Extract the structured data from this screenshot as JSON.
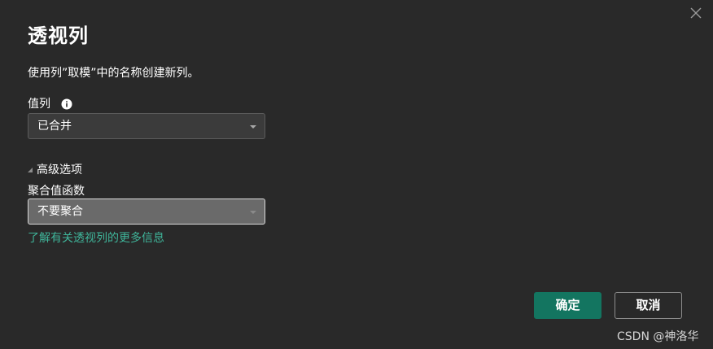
{
  "dialog": {
    "title": "透视列",
    "description": "使用列”取模”中的名称创建新列。",
    "close_icon": "close-icon"
  },
  "value_column": {
    "label": "值列",
    "info_icon": "info-icon",
    "selected": "已合并"
  },
  "advanced": {
    "label": "高级选项",
    "expanded": true
  },
  "aggregate": {
    "label": "聚合值函数",
    "selected": "不要聚合"
  },
  "link": {
    "text": "了解有关透视列的更多信息"
  },
  "buttons": {
    "ok": "确定",
    "cancel": "取消"
  },
  "watermark": "CSDN @神洛华",
  "colors": {
    "background": "#292929",
    "accent": "#137560",
    "link": "#3fb59a"
  }
}
